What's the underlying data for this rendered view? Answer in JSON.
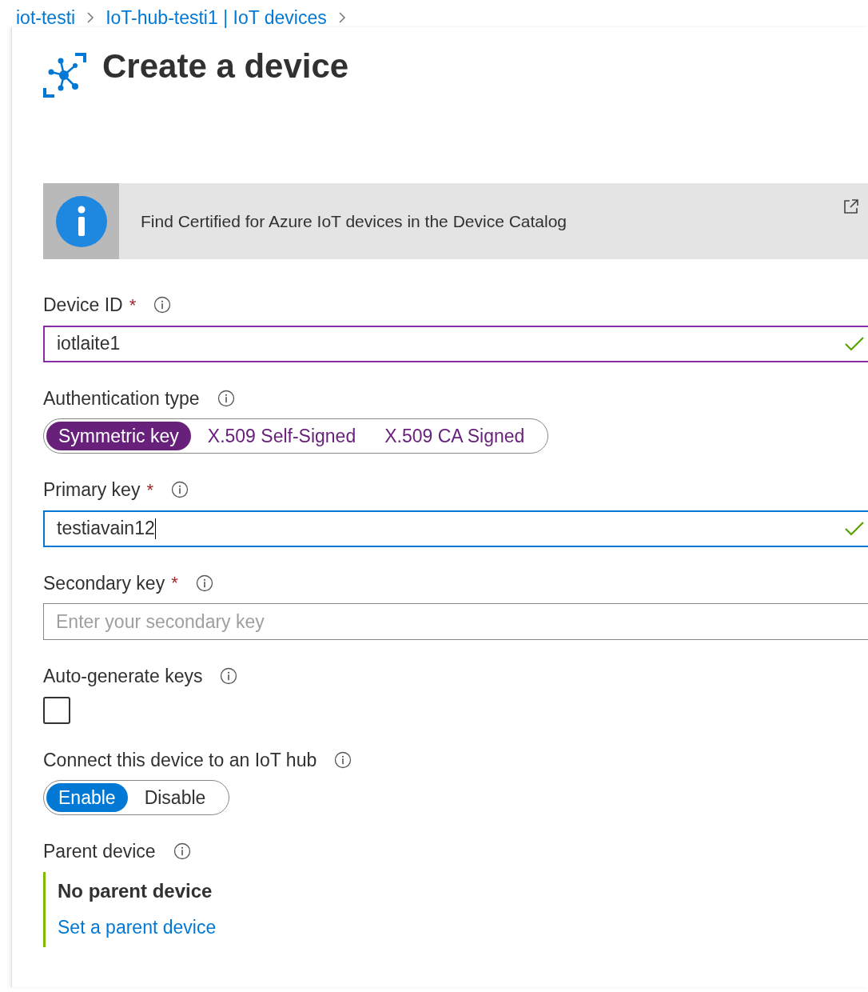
{
  "breadcrumb": [
    "iot-testi",
    "IoT-hub-testi1 | IoT devices"
  ],
  "title": "Create a device",
  "banner": {
    "text": "Find Certified for Azure IoT devices in the Device Catalog"
  },
  "fields": [
    {
      "kind": "text",
      "label": "Device ID",
      "required_mark": "*",
      "value": "iotlaite1",
      "valid": true,
      "focused": false,
      "hovered": true
    },
    {
      "kind": "choice",
      "label": "Authentication type",
      "color": "#68217a",
      "options": [
        {
          "label": "Symmetric key",
          "selected": true
        },
        {
          "label": "X.509 Self-Signed",
          "selected": false
        },
        {
          "label": "X.509 CA Signed",
          "selected": false
        }
      ]
    },
    {
      "kind": "text",
      "label": "Primary key",
      "required_mark": "*",
      "value": "testiavain12",
      "valid": true,
      "focused": true,
      "hovered": false
    },
    {
      "kind": "text",
      "label": "Secondary key",
      "required_mark": "*",
      "placeholder": "Enter your secondary key",
      "valid": false,
      "focused": false,
      "hovered": false
    },
    {
      "kind": "checkbox",
      "label": "Auto-generate keys",
      "checked": false
    },
    {
      "kind": "choice",
      "label": "Connect this device to an IoT hub",
      "color": "#0078d4",
      "options": [
        {
          "label": "Enable",
          "selected": true
        },
        {
          "label": "Disable",
          "selected": false
        }
      ]
    },
    {
      "kind": "parent",
      "label": "Parent device",
      "value": "No parent device",
      "link": "Set a parent device"
    }
  ]
}
